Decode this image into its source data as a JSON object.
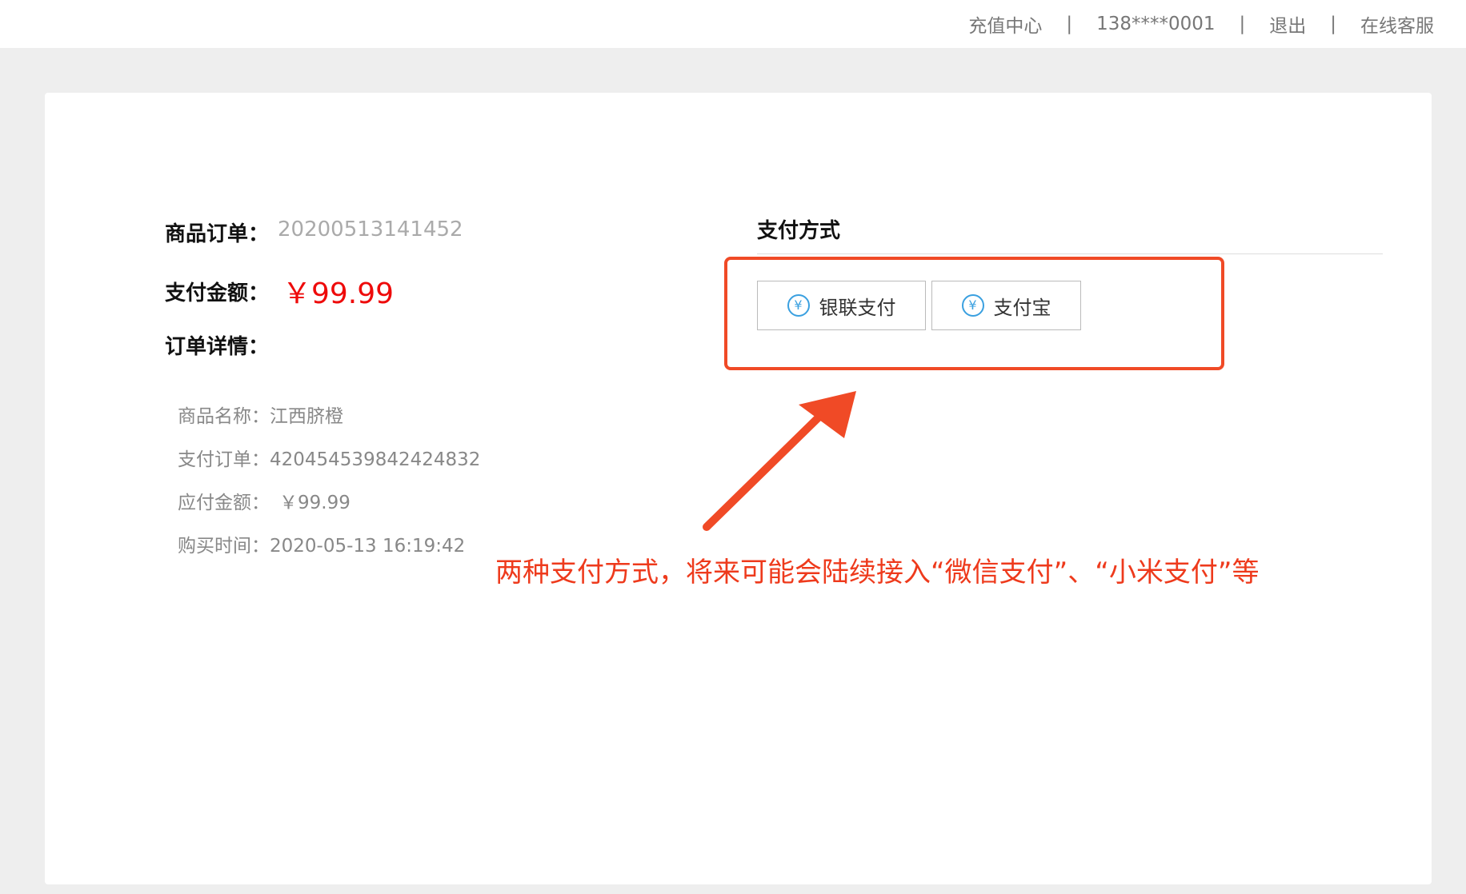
{
  "topnav": {
    "recharge_center": "充值中心",
    "separator": "|",
    "phone": "138****0001",
    "logout": "退出",
    "online_service": "在线客服"
  },
  "order": {
    "order_label": "商品订单：",
    "order_number": "20200513141452",
    "amount_label": "支付金额：",
    "amount_value": "￥99.99",
    "detail_label": "订单详情："
  },
  "details": [
    {
      "label": "商品名称：",
      "value": "江西脐橙"
    },
    {
      "label": "支付订单：",
      "value": "420454539842424832"
    },
    {
      "label": "应付金额：",
      "value": "￥99.99"
    },
    {
      "label": "购买时间：",
      "value": "2020-05-13 16:19:42"
    }
  ],
  "payment": {
    "title": "支付方式",
    "methods": [
      {
        "label": "银联支付",
        "icon": "yen-circle-icon"
      },
      {
        "label": "支付宝",
        "icon": "yen-circle-icon"
      }
    ],
    "icon_glyph": "¥"
  },
  "annotation": {
    "text": "两种支付方式，将来可能会陆续接入“微信支付”、“小米支付”等",
    "color": "#ee3a1c"
  },
  "colors": {
    "accent_red": "#ee0a0a",
    "icon_blue": "#3aa0e0"
  }
}
